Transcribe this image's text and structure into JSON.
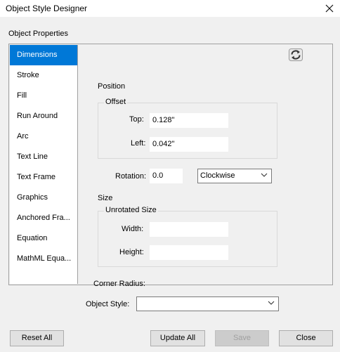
{
  "window": {
    "title": "Object Style Designer"
  },
  "panel": {
    "legend": "Object Properties"
  },
  "sidebar": {
    "items": [
      {
        "label": "Dimensions"
      },
      {
        "label": "Stroke"
      },
      {
        "label": "Fill"
      },
      {
        "label": "Run Around"
      },
      {
        "label": "Arc"
      },
      {
        "label": "Text Line"
      },
      {
        "label": "Text Frame"
      },
      {
        "label": "Graphics"
      },
      {
        "label": "Anchored Fra..."
      },
      {
        "label": "Equation"
      },
      {
        "label": "MathML Equa..."
      }
    ],
    "selected_index": 0
  },
  "position": {
    "heading": "Position",
    "offset_legend": "Offset",
    "top_label": "Top:",
    "top_value": "0.128\"",
    "left_label": "Left:",
    "left_value": "0.042\"",
    "rotation_label": "Rotation:",
    "rotation_value": "0.0",
    "direction_value": "Clockwise"
  },
  "size": {
    "heading": "Size",
    "unrotated_legend": "Unrotated Size",
    "width_label": "Width:",
    "width_value": "",
    "height_label": "Height:",
    "height_value": ""
  },
  "corner": {
    "label": "Corner Radius:"
  },
  "object_style": {
    "label": "Object Style:",
    "value": ""
  },
  "buttons": {
    "reset_all": "Reset All",
    "update_all": "Update All",
    "save": "Save",
    "close": "Close"
  },
  "colors": {
    "accent": "#0078d7",
    "background": "#f0f0f0"
  }
}
